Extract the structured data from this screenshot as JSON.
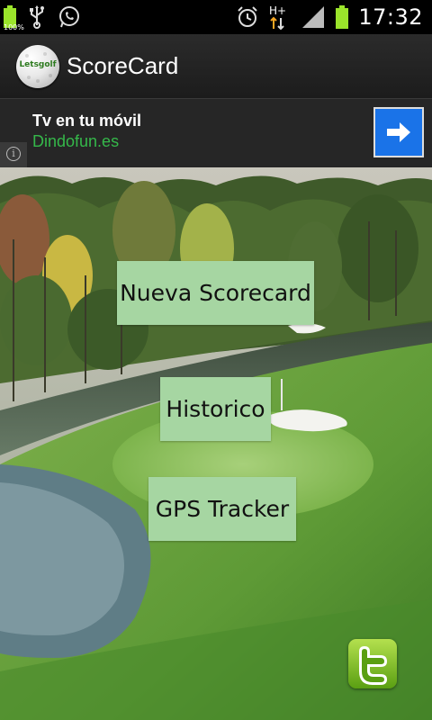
{
  "status_bar": {
    "battery_percent": "100%",
    "time": "17:32",
    "network": "H+"
  },
  "app": {
    "title": "ScoreCard",
    "logo_text": "Letsgolf"
  },
  "ad": {
    "title": "Tv en tu móvil",
    "url": "Dindofun.es",
    "info_glyph": "i"
  },
  "menu": {
    "new_scorecard": "Nueva Scorecard",
    "history": "Historico",
    "gps_tracker": "GPS Tracker"
  },
  "colors": {
    "button_bg": "#a6d6a2",
    "ad_url": "#35b84a",
    "ad_button": "#1a73e8",
    "twitter": "#7bc024"
  }
}
